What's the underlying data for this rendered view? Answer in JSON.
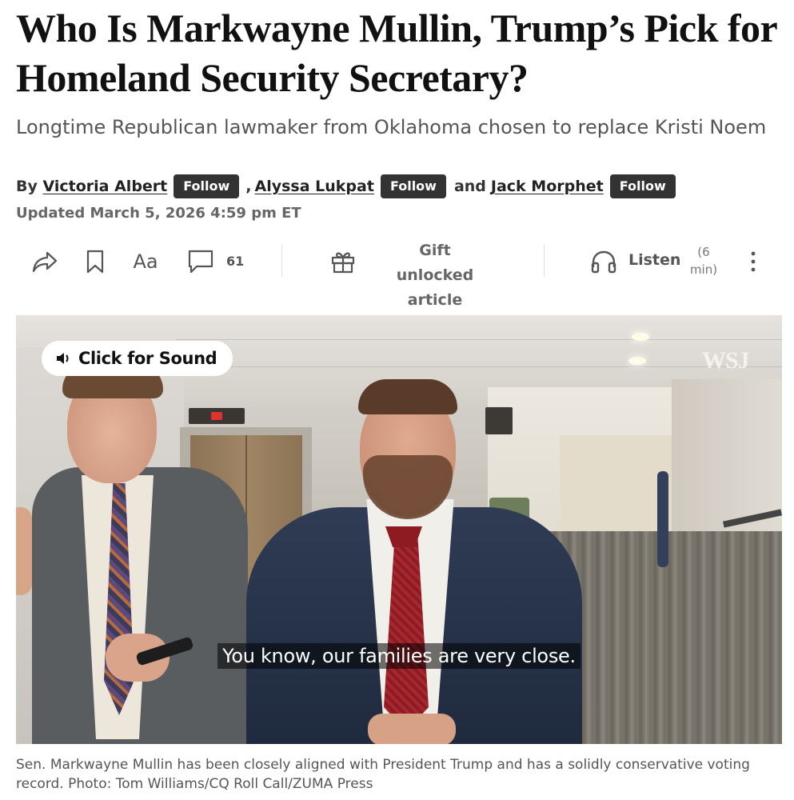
{
  "article": {
    "headline": "Who Is Markwayne Mullin, Trump’s Pick for Homeland Security Secretary?",
    "dek": "Longtime Republican lawmaker from Oklahoma chosen to replace Kristi Noem",
    "byline": {
      "by": "By",
      "authors": [
        {
          "name": "Victoria Albert",
          "follow_label": "Follow"
        },
        {
          "name": "Alyssa Lukpat",
          "follow_label": "Follow"
        },
        {
          "name": "Jack Morphet",
          "follow_label": "Follow"
        }
      ],
      "separator": ",",
      "conjunction": "and"
    },
    "updated": "Updated March 5, 2026 4:59 pm ET"
  },
  "toolbar": {
    "share_icon": "share-icon",
    "bookmark_icon": "bookmark-icon",
    "text_size_label": "Aa",
    "comments_icon": "comment-icon",
    "comments_count": "61",
    "gift_icon": "gift-icon",
    "gift_label_line1": "Gift unlocked",
    "gift_label_line2": "article",
    "listen_icon": "headphones-icon",
    "listen_label": "Listen",
    "listen_duration_line1": "(6",
    "listen_duration_line2": "min)",
    "more_icon": "more-vertical-icon"
  },
  "media": {
    "sound_button_label": "Click for Sound",
    "watermark": "WSJ",
    "subtitle": "You know, our families are very close.",
    "caption": "Sen. Markwayne Mullin has been closely aligned with President Trump and has a solidly conservative voting record. Photo: Tom Williams/CQ Roll Call/ZUMA Press"
  },
  "colors": {
    "follow_bg": "#333333",
    "text_primary": "#111111",
    "text_secondary": "#555555"
  }
}
